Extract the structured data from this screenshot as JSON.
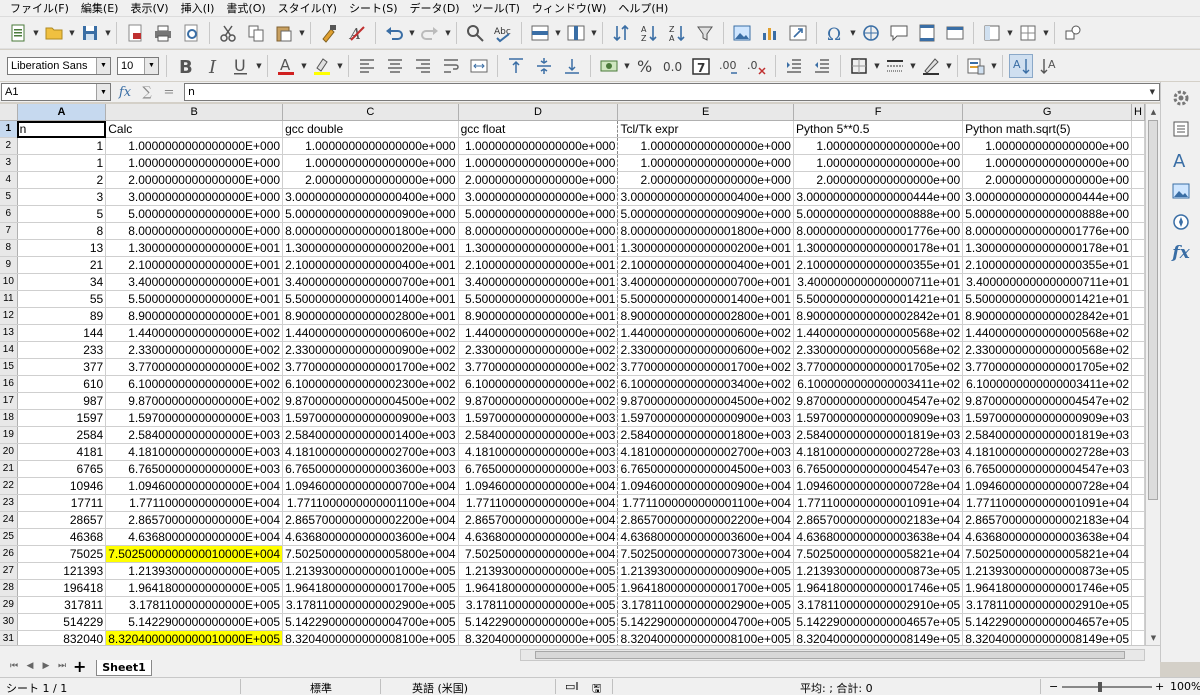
{
  "menu": [
    "ファイル(F)",
    "編集(E)",
    "表示(V)",
    "挿入(I)",
    "書式(O)",
    "スタイル(Y)",
    "シート(S)",
    "データ(D)",
    "ツール(T)",
    "ウィンドウ(W)",
    "ヘルプ(H)"
  ],
  "format_bar": {
    "font_name": "Liberation Sans",
    "font_size": "10"
  },
  "formula_bar": {
    "cell_ref": "A1",
    "content": "n"
  },
  "columns": [
    "",
    "A",
    "B",
    "C",
    "D",
    "E",
    "F",
    "G",
    "H"
  ],
  "header_row": [
    "n",
    "Calc",
    "gcc double",
    "gcc float",
    "Tcl/Tk expr",
    "Python 5**0.5",
    "Python math.sqrt(5)",
    ""
  ],
  "rows": [
    [
      "1",
      "1.0000000000000000E+000",
      "1.0000000000000000e+000",
      "1.0000000000000000e+000",
      "1.0000000000000000e+000",
      "1.0000000000000000e+00",
      "1.0000000000000000e+00"
    ],
    [
      "1",
      "1.0000000000000000E+000",
      "1.0000000000000000e+000",
      "1.0000000000000000e+000",
      "1.0000000000000000e+000",
      "1.0000000000000000e+00",
      "1.0000000000000000e+00"
    ],
    [
      "2",
      "2.0000000000000000E+000",
      "2.0000000000000000e+000",
      "2.0000000000000000e+000",
      "2.0000000000000000e+000",
      "2.0000000000000000e+00",
      "2.0000000000000000e+00"
    ],
    [
      "3",
      "3.0000000000000000E+000",
      "3.0000000000000000400e+000",
      "3.0000000000000000e+000",
      "3.0000000000000000400e+000",
      "3.0000000000000000444e+00",
      "3.0000000000000000444e+00"
    ],
    [
      "5",
      "5.0000000000000000E+000",
      "5.0000000000000000900e+000",
      "5.0000000000000000e+000",
      "5.0000000000000000900e+000",
      "5.0000000000000000888e+00",
      "5.0000000000000000888e+00"
    ],
    [
      "8",
      "8.0000000000000000E+000",
      "8.0000000000000001800e+000",
      "8.0000000000000000e+000",
      "8.0000000000000001800e+000",
      "8.0000000000000001776e+00",
      "8.0000000000000001776e+00"
    ],
    [
      "13",
      "1.3000000000000000E+001",
      "1.3000000000000000200e+001",
      "1.3000000000000000e+001",
      "1.3000000000000000200e+001",
      "1.3000000000000000178e+01",
      "1.3000000000000000178e+01"
    ],
    [
      "21",
      "2.1000000000000000E+001",
      "2.1000000000000000400e+001",
      "2.1000000000000000e+001",
      "2.1000000000000000400e+001",
      "2.1000000000000000355e+01",
      "2.1000000000000000355e+01"
    ],
    [
      "34",
      "3.4000000000000000E+001",
      "3.4000000000000000700e+001",
      "3.4000000000000000e+001",
      "3.4000000000000000700e+001",
      "3.4000000000000000711e+01",
      "3.4000000000000000711e+01"
    ],
    [
      "55",
      "5.5000000000000000E+001",
      "5.5000000000000001400e+001",
      "5.5000000000000000e+001",
      "5.5000000000000001400e+001",
      "5.5000000000000001421e+01",
      "5.5000000000000001421e+01"
    ],
    [
      "89",
      "8.9000000000000000E+001",
      "8.9000000000000002800e+001",
      "8.9000000000000000e+001",
      "8.9000000000000002800e+001",
      "8.9000000000000002842e+01",
      "8.9000000000000002842e+01"
    ],
    [
      "144",
      "1.4400000000000000E+002",
      "1.4400000000000000600e+002",
      "1.4400000000000000e+002",
      "1.4400000000000000600e+002",
      "1.4400000000000000568e+02",
      "1.4400000000000000568e+02"
    ],
    [
      "233",
      "2.3300000000000000E+002",
      "2.3300000000000000900e+002",
      "2.3300000000000000e+002",
      "2.3300000000000000600e+002",
      "2.3300000000000000568e+02",
      "2.3300000000000000568e+02"
    ],
    [
      "377",
      "3.7700000000000000E+002",
      "3.7700000000000001700e+002",
      "3.7700000000000000e+002",
      "3.7700000000000001700e+002",
      "3.7700000000000001705e+02",
      "3.7700000000000001705e+02"
    ],
    [
      "610",
      "6.1000000000000000E+002",
      "6.1000000000000002300e+002",
      "6.1000000000000000e+002",
      "6.1000000000000003400e+002",
      "6.1000000000000003411e+02",
      "6.1000000000000003411e+02"
    ],
    [
      "987",
      "9.8700000000000000E+002",
      "9.8700000000000004500e+002",
      "9.8700000000000000e+002",
      "9.8700000000000004500e+002",
      "9.8700000000000004547e+02",
      "9.8700000000000004547e+02"
    ],
    [
      "1597",
      "1.5970000000000000E+003",
      "1.5970000000000000900e+003",
      "1.5970000000000000e+003",
      "1.5970000000000000900e+003",
      "1.5970000000000000909e+03",
      "1.5970000000000000909e+03"
    ],
    [
      "2584",
      "2.5840000000000000E+003",
      "2.5840000000000001400e+003",
      "2.5840000000000000e+003",
      "2.5840000000000001800e+003",
      "2.5840000000000001819e+03",
      "2.5840000000000001819e+03"
    ],
    [
      "4181",
      "4.1810000000000000E+003",
      "4.1810000000000002700e+003",
      "4.1810000000000000e+003",
      "4.1810000000000002700e+003",
      "4.1810000000000002728e+03",
      "4.1810000000000002728e+03"
    ],
    [
      "6765",
      "6.7650000000000000E+003",
      "6.7650000000000003600e+003",
      "6.7650000000000000e+003",
      "6.7650000000000004500e+003",
      "6.7650000000000004547e+03",
      "6.7650000000000004547e+03"
    ],
    [
      "10946",
      "1.0946000000000000E+004",
      "1.0946000000000000700e+004",
      "1.0946000000000000e+004",
      "1.0946000000000000900e+004",
      "1.0946000000000000728e+04",
      "1.0946000000000000728e+04"
    ],
    [
      "17711",
      "1.7711000000000000E+004",
      "1.7711000000000001100e+004",
      "1.7711000000000000e+004",
      "1.7711000000000001100e+004",
      "1.7711000000000001091e+04",
      "1.7711000000000001091e+04"
    ],
    [
      "28657",
      "2.8657000000000000E+004",
      "2.8657000000000002200e+004",
      "2.8657000000000000e+004",
      "2.8657000000000002200e+004",
      "2.8657000000000002183e+04",
      "2.8657000000000002183e+04"
    ],
    [
      "46368",
      "4.6368000000000000E+004",
      "4.6368000000000003600e+004",
      "4.6368000000000000e+004",
      "4.6368000000000003600e+004",
      "4.6368000000000003638e+04",
      "4.6368000000000003638e+04"
    ],
    [
      "75025",
      "7.5025000000000010000E+004",
      "7.5025000000000005800e+004",
      "7.5025000000000000e+004",
      "7.5025000000000007300e+004",
      "7.5025000000000005821e+04",
      "7.5025000000000005821e+04"
    ],
    [
      "121393",
      "1.2139300000000000E+005",
      "1.2139300000000001000e+005",
      "1.2139300000000000e+005",
      "1.2139300000000000900e+005",
      "1.2139300000000000873e+05",
      "1.2139300000000000873e+05"
    ],
    [
      "196418",
      "1.9641800000000000E+005",
      "1.9641800000000001700e+005",
      "1.9641800000000000e+005",
      "1.9641800000000001700e+005",
      "1.9641800000000001746e+05",
      "1.9641800000000001746e+05"
    ],
    [
      "317811",
      "3.1781100000000000E+005",
      "3.1781100000000002900e+005",
      "3.1781100000000000e+005",
      "3.1781100000000002900e+005",
      "3.1781100000000002910e+05",
      "3.1781100000000002910e+05"
    ],
    [
      "514229",
      "5.1422900000000000E+005",
      "5.1422900000000004700e+005",
      "5.1422900000000000e+005",
      "5.1422900000000004700e+005",
      "5.1422900000000004657e+05",
      "5.1422900000000004657e+05"
    ],
    [
      "832040",
      "8.3204000000000010000E+005",
      "8.3204000000000008100e+005",
      "8.3204000000000000e+005",
      "8.3204000000000008100e+005",
      "8.3204000000000008149e+05",
      "8.3204000000000008149e+05"
    ]
  ],
  "highlighted_cells": [
    "B26",
    "B31"
  ],
  "highlight_color": "#ffff00",
  "sheet_tab": "Sheet1",
  "status": {
    "sheet": "シート 1 / 1",
    "style": "標準",
    "language": "英語 (米国)",
    "summary": "平均: ; 合計: 0",
    "zoom": "100%"
  }
}
